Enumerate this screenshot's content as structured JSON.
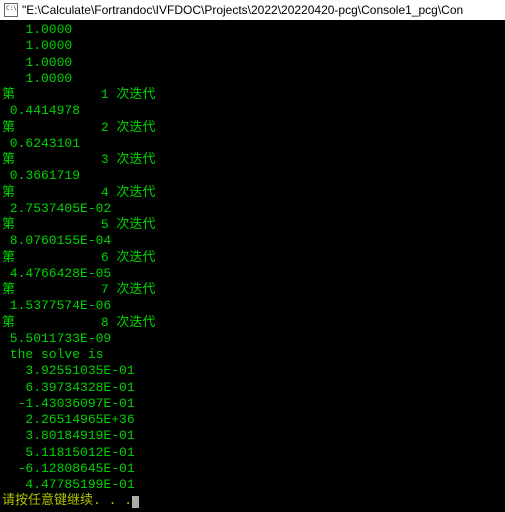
{
  "titlebar": {
    "path": "\"E:\\Calculate\\Fortrandoc\\IVFDOC\\Projects\\2022\\20220420-pcg\\Console1_pcg\\Con"
  },
  "initial_values": [
    "   1.0000",
    "   1.0000",
    "   1.0000",
    "   1.0000"
  ],
  "iterations": [
    {
      "iter_line": "第           1 次迭代",
      "value_line": " 0.4414978"
    },
    {
      "iter_line": "第           2 次迭代",
      "value_line": " 0.6243101"
    },
    {
      "iter_line": "第           3 次迭代",
      "value_line": " 0.3661719"
    },
    {
      "iter_line": "第           4 次迭代",
      "value_line": " 2.7537405E-02"
    },
    {
      "iter_line": "第           5 次迭代",
      "value_line": " 8.0760155E-04"
    },
    {
      "iter_line": "第           6 次迭代",
      "value_line": " 4.4766428E-05"
    },
    {
      "iter_line": "第           7 次迭代",
      "value_line": " 1.5377574E-06"
    },
    {
      "iter_line": "第           8 次迭代",
      "value_line": " 5.5011733E-09"
    }
  ],
  "solve_header": " the solve is",
  "solve_values": [
    "   3.92551035E-01",
    "   6.39734328E-01",
    "  -1.43036097E-01",
    "   2.26514965E+36",
    "   3.80184919E-01",
    "   5.11815012E-01",
    "  -6.12808645E-01",
    "   4.47785199E-01"
  ],
  "prompt": "请按任意键继续. . ."
}
